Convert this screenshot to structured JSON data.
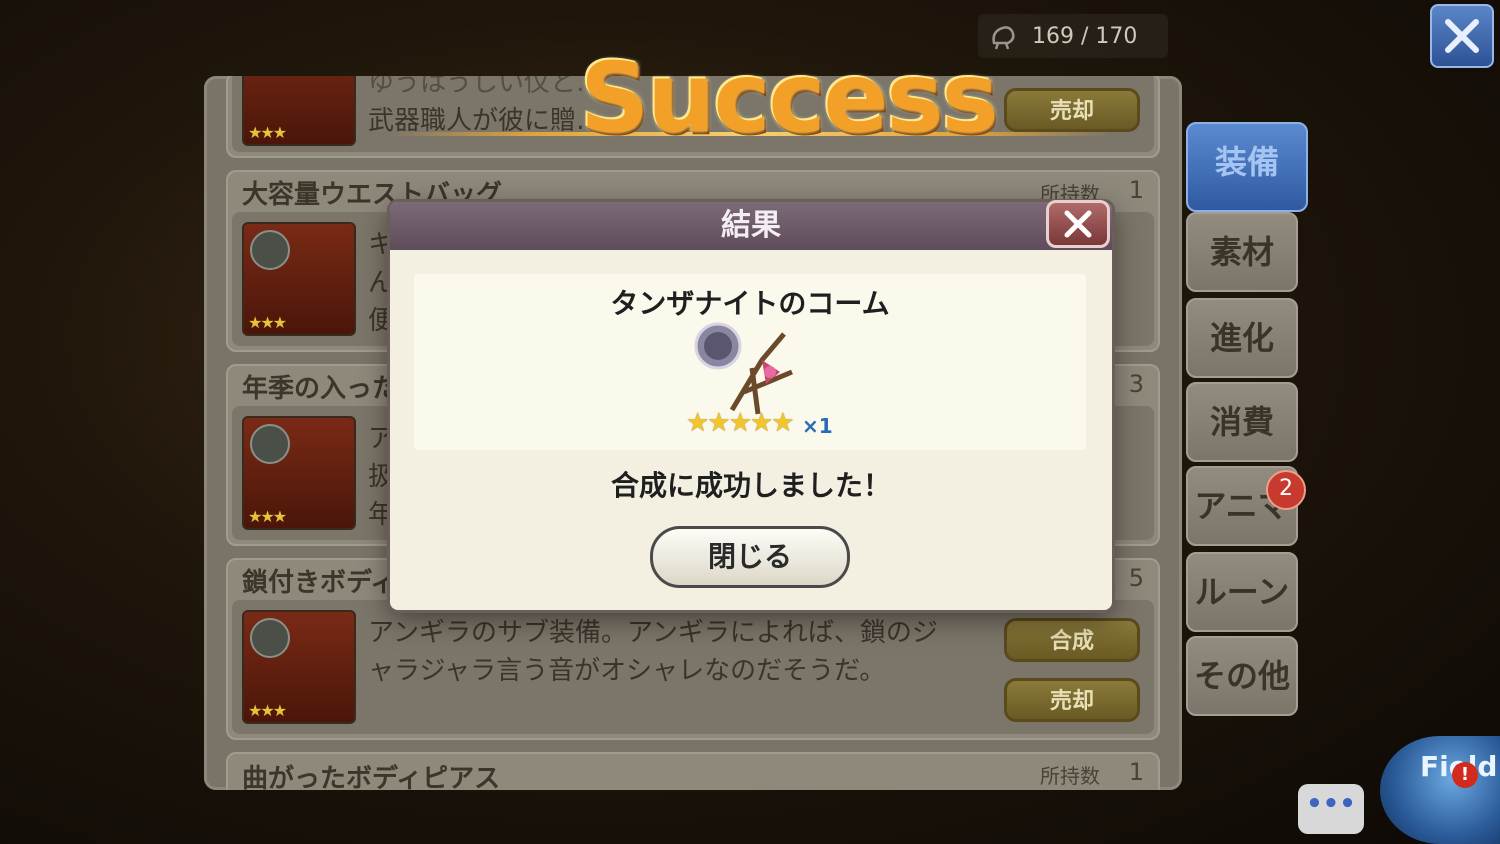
{
  "header": {
    "capacity_text": "169 / 170",
    "capacity_icon": "bag-icon"
  },
  "banner": {
    "title": "Success"
  },
  "inventory": {
    "rows": [
      {
        "name": "",
        "owned_label": "",
        "count": "",
        "stars": "★★★",
        "description": [
          "ゆうはうしい仪と……",
          "武器職人が彼に贈……"
        ],
        "buttons": [
          "売却"
        ]
      },
      {
        "name": "大容量ウエストバッグ",
        "owned_label": "所持数",
        "count": "1",
        "stars": "★★★",
        "description": [
          "キ",
          "ん",
          "便"
        ],
        "buttons": []
      },
      {
        "name": "年季の入った",
        "owned_label": "",
        "count": "3",
        "stars": "★★★",
        "description": [
          "ア",
          "扱",
          "年"
        ],
        "buttons": []
      },
      {
        "name": "鎖付きボディ",
        "owned_label": "",
        "count": "5",
        "stars": "★★★",
        "description": [
          "アンギラのサブ装備。アンギラによれば、鎖のジ",
          "ャラジャラ言う音がオシャレなのだそうだ。"
        ],
        "buttons": [
          "合成",
          "売却"
        ]
      },
      {
        "name": "曲がったボディピアス",
        "owned_label": "所持数",
        "count": "1",
        "stars": "",
        "description": [],
        "buttons": []
      }
    ]
  },
  "tabs": [
    {
      "label": "装備",
      "active": true
    },
    {
      "label": "素材",
      "active": false
    },
    {
      "label": "進化",
      "active": false
    },
    {
      "label": "消費",
      "active": false
    },
    {
      "label": "アニマ",
      "active": false,
      "badge": "2"
    },
    {
      "label": "ルーン",
      "active": false
    },
    {
      "label": "その他",
      "active": false
    }
  ],
  "modal": {
    "title": "結果",
    "item_name": "タンザナイトのコーム",
    "item_stars": "★★★★★",
    "item_qty": "×1",
    "message": "合成に成功しました！",
    "close_button": "閉じる"
  },
  "footer": {
    "chat_label": "•••",
    "field_label": "Field",
    "field_alert": "!"
  },
  "colors": {
    "accent_gold": "#f2a028",
    "tab_active": "#2f5aa0",
    "modal_header": "#5e4c5a"
  }
}
